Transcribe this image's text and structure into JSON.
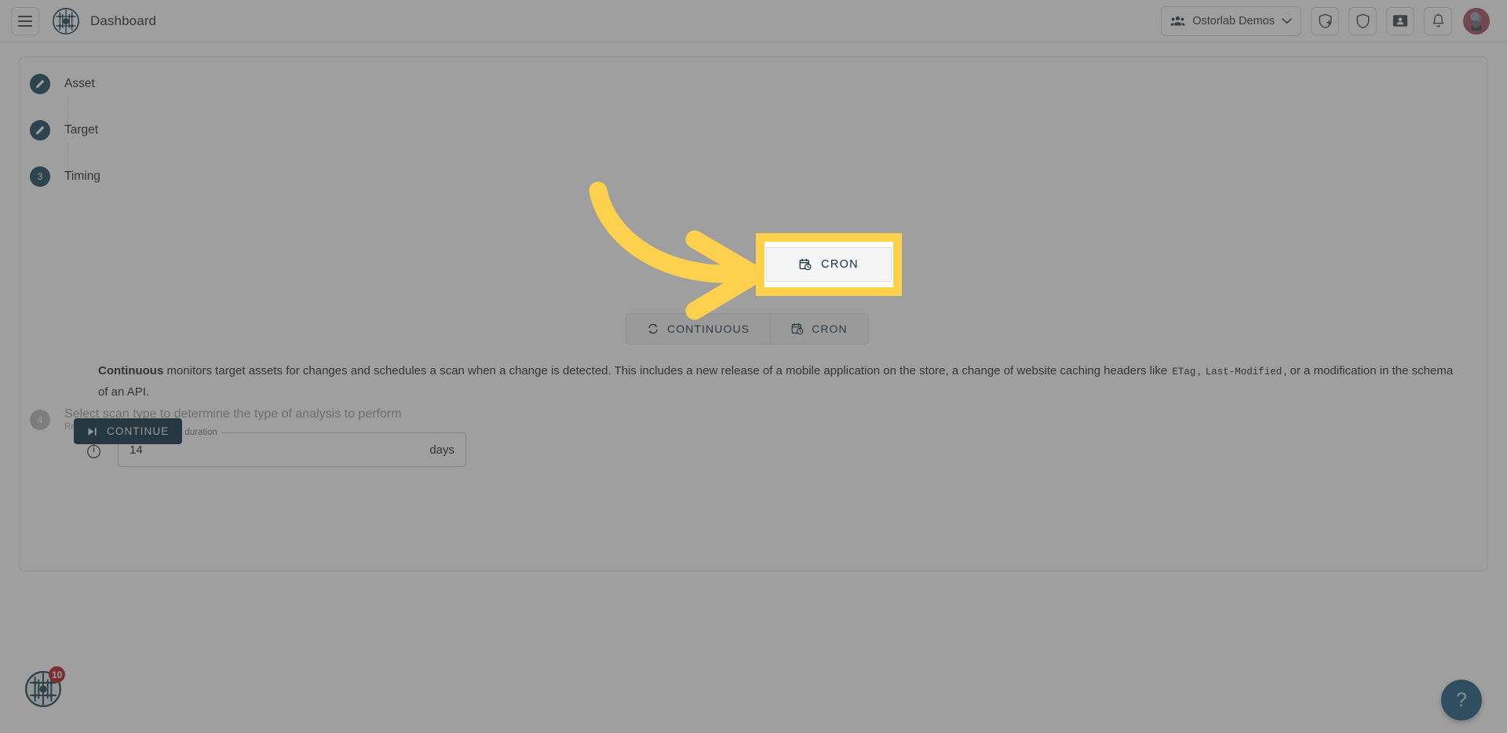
{
  "header": {
    "title": "Dashboard",
    "menu_icon": "hamburger-menu-icon",
    "logo_icon": "ostorlab-logo-icon",
    "org_selector": {
      "label": "Ostorlab Demos",
      "leading_icon": "people-group-icon",
      "trailing_icon": "chevron-down-icon"
    },
    "actions": [
      {
        "name": "add-scan-button",
        "icon": "shield-plus-icon"
      },
      {
        "name": "security-button",
        "icon": "shield-icon"
      },
      {
        "name": "tickets-button",
        "icon": "id-card-icon"
      },
      {
        "name": "notifications-button",
        "icon": "bell-icon"
      }
    ],
    "avatar_alt": "user-avatar"
  },
  "stepper": {
    "steps": [
      {
        "marker": "edit",
        "label": "Asset",
        "state": "completed"
      },
      {
        "marker": "edit",
        "label": "Target",
        "state": "completed"
      },
      {
        "marker": "3",
        "label": "Timing",
        "state": "active"
      },
      {
        "marker": "4",
        "label": "Select scan type to determine the type of analysis to perform",
        "sub": "Required",
        "state": "pending"
      }
    ]
  },
  "timing": {
    "mode_toggle": {
      "options": [
        {
          "value": "continuous",
          "label": "CONTINUOUS",
          "icon": "sync-refresh-icon",
          "selected": false
        },
        {
          "value": "cron",
          "label": "CRON",
          "icon": "calendar-clock-icon",
          "selected": false
        }
      ]
    },
    "description": {
      "lead": "Continuous",
      "part1": " monitors target assets for changes and schedules a scan when a change is detected. This includes a new release of a mobile application on the store, a change of website caching headers like ",
      "code1": "ETag",
      "sep1": ",",
      "code2": "Last-Modified",
      "part2": ", or a modification in the schema of an API."
    },
    "duration_field": {
      "leading_icon": "stopwatch-timer-icon",
      "label": "Max no scan duration",
      "value": "14",
      "placeholder": "",
      "suffix": "days"
    },
    "continue_button": {
      "label": "CONTINUE",
      "icon": "skip-next-icon"
    }
  },
  "floating": {
    "logo_badge_count": "10",
    "logo_icon": "ostorlab-circuit-logo-icon",
    "help_label": "?",
    "help_icon": "question-mark-icon"
  },
  "annotation": {
    "arrow_icon": "curved-arrow-icon",
    "highlight_color": "#ffd24a",
    "target_label": "CRON",
    "target_icon": "calendar-clock-icon"
  }
}
